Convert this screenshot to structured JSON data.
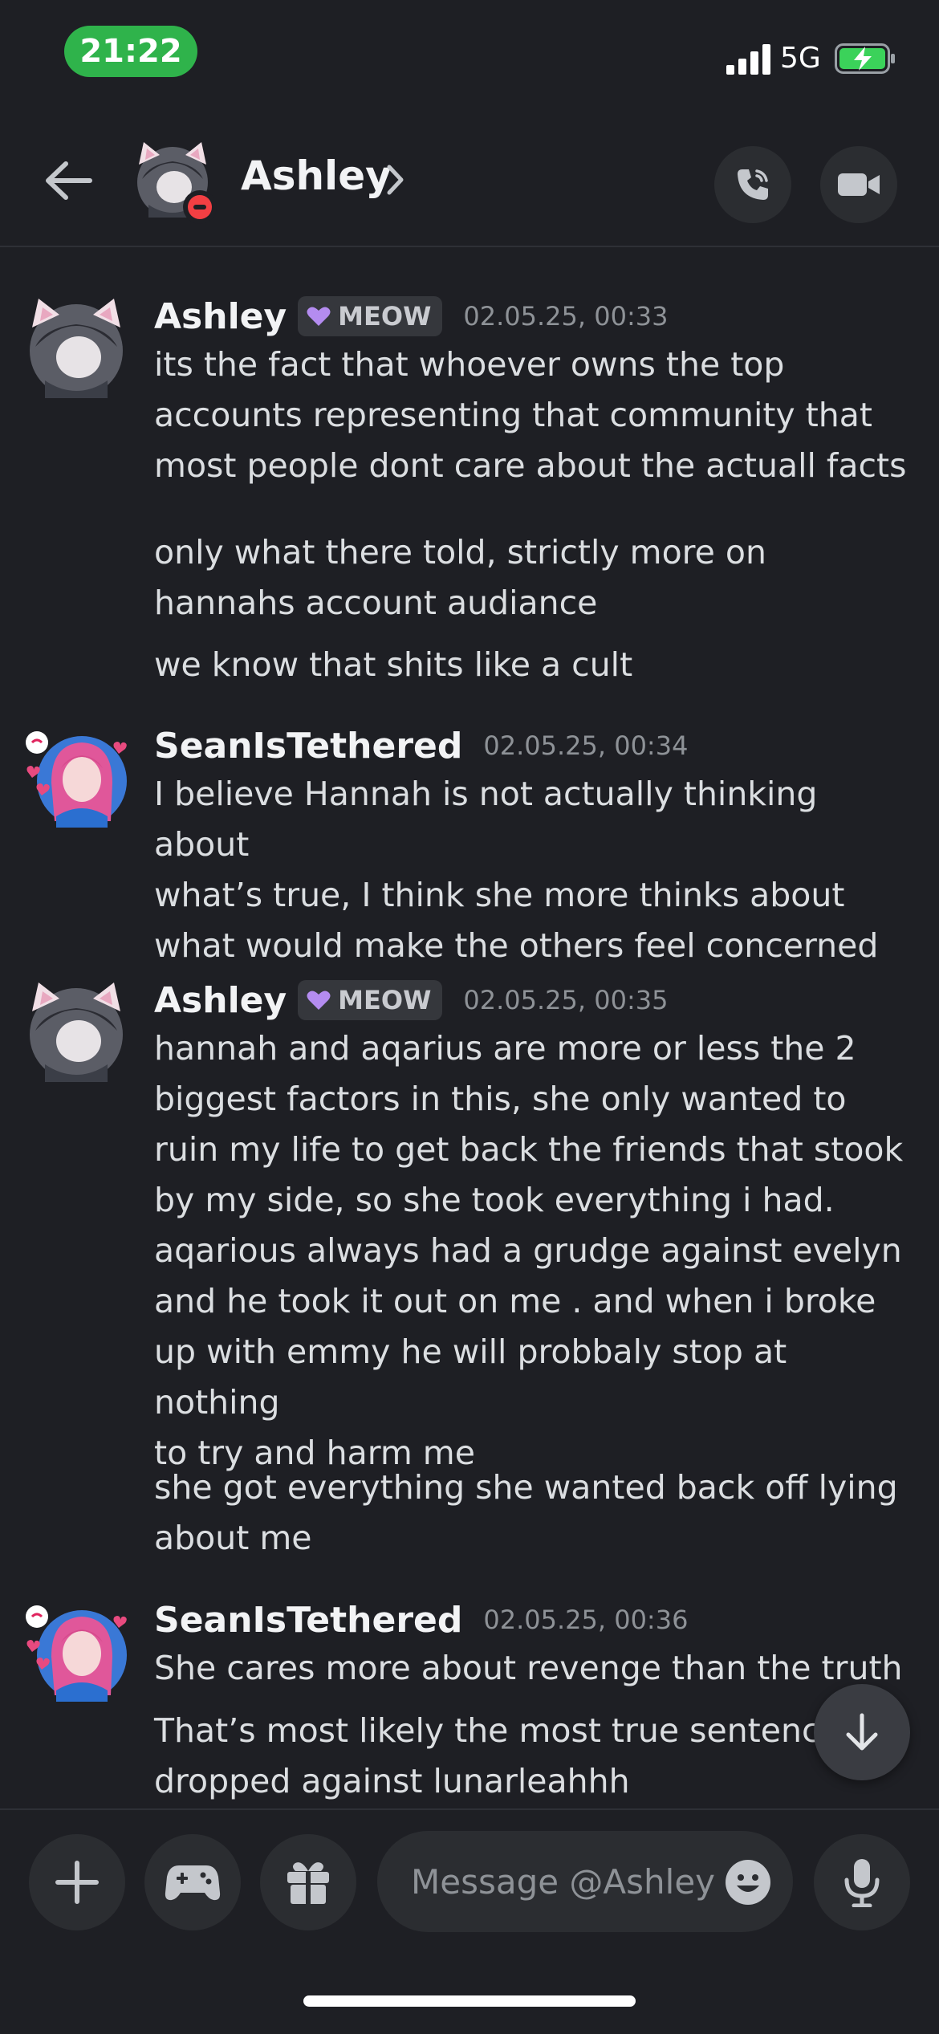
{
  "status_bar": {
    "time": "21:22",
    "network": "5G"
  },
  "header": {
    "name": "Ashley",
    "avatar": "cat-ears-avatar",
    "status": "do-not-disturb"
  },
  "colors": {
    "background": "#1e1f24",
    "time_pill": "#2fb34b",
    "dnd": "#f23f43",
    "battery": "#3bd25a"
  },
  "messages": [
    {
      "author": "Ashley",
      "tag": "MEOW",
      "timestamp": "02.05.25, 00:33",
      "lines": [
        "its the fact that whoever owns the top\naccounts representing that community that\nmost people dont care about the actuall facts",
        "only what there told,  strictly more on\nhannahs account audiance",
        "we know that shits like a cult"
      ]
    },
    {
      "author": "SeanIsTethered",
      "tag": "",
      "timestamp": "02.05.25, 00:34",
      "lines": [
        "I believe Hannah is not actually thinking about\nwhat’s true, I think she more thinks about\nwhat would make the others feel concerned"
      ]
    },
    {
      "author": "Ashley",
      "tag": "MEOW",
      "timestamp": "02.05.25, 00:35",
      "lines": [
        "hannah and aqarius are more or less the 2\nbiggest factors in this,  she only wanted to\nruin my life to get back the friends that stook\nby my side, so she took everything i had.\naqarious always had a grudge against evelyn\nand he took it out on me .  and when i broke\nup with emmy he will probbaly stop at nothing\nto try and harm me",
        "she got everything she wanted back  off lying\nabout me"
      ]
    },
    {
      "author": "SeanIsTethered",
      "tag": "",
      "timestamp": "02.05.25, 00:36",
      "lines": [
        "She cares more about revenge than the truth",
        "That’s most likely the most true sentence\ndropped against lunarleahhh"
      ]
    }
  ],
  "composer": {
    "placeholder": "Message @Ashley"
  },
  "icons": {
    "back": "arrow-left-icon",
    "call": "phone-icon",
    "video": "video-camera-icon",
    "add": "plus-icon",
    "games": "gamepad-icon",
    "gift": "gift-icon",
    "emoji": "emoji-icon",
    "mic": "microphone-icon",
    "scroll": "arrow-down-icon"
  }
}
